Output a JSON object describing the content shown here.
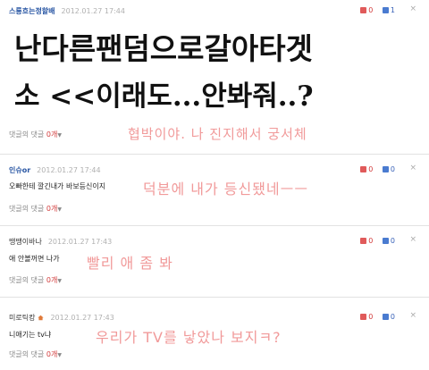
{
  "comments": [
    {
      "nickname": "스룡흐는정할배",
      "date": "2012.01.27 17:44",
      "up": "0",
      "down": "1",
      "close": "×",
      "body_lines": [
        "난다른팬덤으로갈아타겟",
        "소 <<이래도...안봐줘..?"
      ],
      "reply_label": "댓글의 댓글",
      "reply_count": "0개",
      "note": "협박이야. 나 진지해서 궁서체"
    },
    {
      "nickname": "인슈or",
      "date": "2012.01.27 17:44",
      "up": "0",
      "down": "0",
      "close": "×",
      "body": "오빠한테 깔긴내가 바보등신이지",
      "reply_label": "댓글의 댓글",
      "reply_count": "0개",
      "note": "덕분에 내가 등신됐네ㅡㅡ"
    },
    {
      "nickname": "땡땡이바나",
      "date": "2012.01.27 17:43",
      "up": "0",
      "down": "0",
      "close": "×",
      "body": "애 안볼꺼면 나가",
      "reply_label": "댓글의 댓글",
      "reply_count": "0개",
      "note": "빨리 애 좀 봐"
    },
    {
      "nickname": "미로틱캉",
      "date": "2012.01.27 17:43",
      "up": "0",
      "down": "0",
      "close": "×",
      "body": "니애기는 tv냐",
      "reply_label": "댓글의 댓글",
      "reply_count": "0개",
      "note": "우리가 TV를 낳았나 보지ㅋ?"
    }
  ],
  "colors": {
    "nickname": "#2a57a4",
    "vote_up": "#d23b3b",
    "vote_down": "#3a63b8",
    "handwriting": "#f19a9a",
    "divider": "#e2e2e2"
  },
  "icons": {
    "vote_up": "thumbs-up-icon",
    "vote_down": "thumbs-down-icon",
    "close": "close-icon",
    "reply_toggle": "chevron-down-icon",
    "home": "home-icon"
  }
}
